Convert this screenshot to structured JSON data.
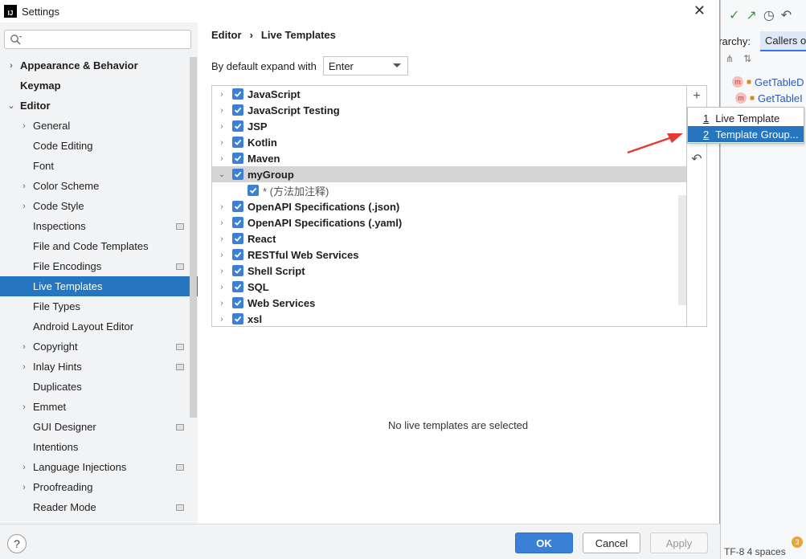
{
  "window": {
    "title": "Settings",
    "close_glyph": "✕"
  },
  "sidebar": {
    "search_placeholder": "",
    "items": [
      {
        "label": "Appearance & Behavior",
        "level": 0,
        "chevron": "›"
      },
      {
        "label": "Keymap",
        "level": 0
      },
      {
        "label": "Editor",
        "level": 0,
        "chevron": "⌄"
      },
      {
        "label": "General",
        "level": 1,
        "chevron": "›"
      },
      {
        "label": "Code Editing",
        "level": 1
      },
      {
        "label": "Font",
        "level": 1
      },
      {
        "label": "Color Scheme",
        "level": 1,
        "chevron": "›"
      },
      {
        "label": "Code Style",
        "level": 1,
        "chevron": "›"
      },
      {
        "label": "Inspections",
        "level": 1,
        "project": true
      },
      {
        "label": "File and Code Templates",
        "level": 1
      },
      {
        "label": "File Encodings",
        "level": 1,
        "project": true
      },
      {
        "label": "Live Templates",
        "level": 1,
        "selected": true
      },
      {
        "label": "File Types",
        "level": 1
      },
      {
        "label": "Android Layout Editor",
        "level": 1
      },
      {
        "label": "Copyright",
        "level": 1,
        "chevron": "›",
        "project": true
      },
      {
        "label": "Inlay Hints",
        "level": 1,
        "chevron": "›",
        "project": true
      },
      {
        "label": "Duplicates",
        "level": 1
      },
      {
        "label": "Emmet",
        "level": 1,
        "chevron": "›"
      },
      {
        "label": "GUI Designer",
        "level": 1,
        "project": true
      },
      {
        "label": "Intentions",
        "level": 1
      },
      {
        "label": "Language Injections",
        "level": 1,
        "chevron": "›",
        "project": true
      },
      {
        "label": "Proofreading",
        "level": 1,
        "chevron": "›"
      },
      {
        "label": "Reader Mode",
        "level": 1,
        "project": true
      }
    ]
  },
  "breadcrumb": {
    "parent": "Editor",
    "separator": "›",
    "current": "Live Templates"
  },
  "expand": {
    "label": "By default expand with",
    "value": "Enter"
  },
  "templates": [
    {
      "label": "JavaScript",
      "chevron": "›"
    },
    {
      "label": "JavaScript Testing",
      "chevron": "›"
    },
    {
      "label": "JSP",
      "chevron": "›"
    },
    {
      "label": "Kotlin",
      "chevron": "›"
    },
    {
      "label": "Maven",
      "chevron": "›"
    },
    {
      "label": "myGroup",
      "chevron": "⌄",
      "selected": true
    },
    {
      "label": "* (方法加注释)",
      "child": true
    },
    {
      "label": "OpenAPI Specifications (.json)",
      "chevron": "›"
    },
    {
      "label": "OpenAPI Specifications (.yaml)",
      "chevron": "›"
    },
    {
      "label": "React",
      "chevron": "›"
    },
    {
      "label": "RESTful Web Services",
      "chevron": "›"
    },
    {
      "label": "Shell Script",
      "chevron": "›"
    },
    {
      "label": "SQL",
      "chevron": "›"
    },
    {
      "label": "Web Services",
      "chevron": "›"
    },
    {
      "label": "xsl",
      "chevron": "›"
    }
  ],
  "tools": {
    "add": "+",
    "undo": "↶"
  },
  "popup": [
    {
      "num": "1",
      "label": "Live Template"
    },
    {
      "num": "2",
      "label": "Template Group...",
      "highlighted": true
    }
  ],
  "empty_message": "No live templates are selected",
  "footer": {
    "help": "?",
    "ok": "OK",
    "cancel": "Cancel",
    "apply": "Apply"
  },
  "background_ide": {
    "hierarchy_label": "erarchy:",
    "callers_tab": "Callers o",
    "rows": [
      "GetTableD",
      "GetTableI"
    ],
    "status": "TF-8   4 spaces",
    "badge": "3",
    "method_badge": "m"
  },
  "colors": {
    "accent": "#2675bf",
    "checkbox": "#3a80d6",
    "arrow": "#e53935"
  }
}
